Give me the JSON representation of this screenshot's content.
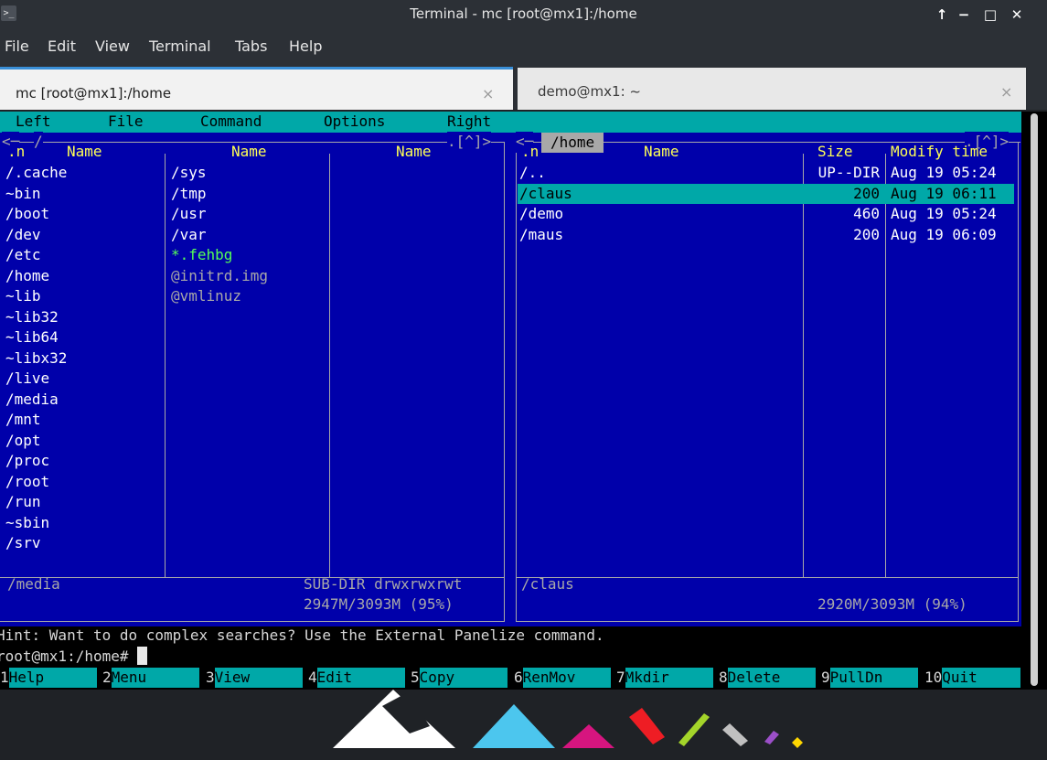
{
  "window": {
    "title": "Terminal - mc [root@mx1]:/home",
    "controls": {
      "up": "↑",
      "minimize": "−",
      "maximize": "□",
      "close": "✕"
    }
  },
  "menubar": [
    "File",
    "Edit",
    "View",
    "Terminal",
    "Tabs",
    "Help"
  ],
  "tabs": [
    {
      "label": "mc [root@mx1]:/home",
      "close": "×",
      "active": true
    },
    {
      "label": "demo@mx1: ~",
      "close": "×",
      "active": false
    }
  ],
  "mc": {
    "menu": [
      "Left",
      "File",
      "Command",
      "Options",
      "Right"
    ],
    "left_panel": {
      "path_label": "/",
      "left_corner": "<─",
      "right_corner": ".[^]>",
      "headers": [
        ".n",
        "Name",
        "Name",
        "Name"
      ],
      "col1": [
        "/.cache",
        "~bin",
        "/boot",
        "/dev",
        "/etc",
        "/home",
        "~lib",
        "~lib32",
        "~lib64",
        "~libx32",
        "/live",
        "/media",
        "/mnt",
        "/opt",
        "/proc",
        "/root",
        "/run",
        "~sbin",
        "/srv"
      ],
      "col2": [
        {
          "name": "/sys",
          "style": "normal"
        },
        {
          "name": "/tmp",
          "style": "normal"
        },
        {
          "name": "/usr",
          "style": "normal"
        },
        {
          "name": "/var",
          "style": "normal"
        },
        {
          "name": "*.fehbg",
          "style": "exec"
        },
        {
          "name": "@initrd.img",
          "style": "link"
        },
        {
          "name": "@vmlinuz",
          "style": "link"
        }
      ],
      "status_name": "/media",
      "status_info": "SUB-DIR drwxrwxrwt",
      "disk": "2947M/3093M (95%)"
    },
    "right_panel": {
      "path_label": "/home",
      "left_corner": "<─",
      "right_corner": ".[^]>",
      "headers": {
        "n": ".n",
        "name": "Name",
        "size": "Size",
        "mtime": "Modify time"
      },
      "rows": [
        {
          "name": "/..",
          "size": "UP--DIR",
          "mtime": "Aug 19 05:24",
          "selected": false
        },
        {
          "name": "/claus",
          "size": "200",
          "mtime": "Aug 19 06:11",
          "selected": true
        },
        {
          "name": "/demo",
          "size": "460",
          "mtime": "Aug 19 05:24",
          "selected": false
        },
        {
          "name": "/maus",
          "size": "200",
          "mtime": "Aug 19 06:09",
          "selected": false
        }
      ],
      "status_name": "/claus",
      "disk": "2920M/3093M (94%)"
    },
    "hint": "Hint: Want to do complex searches? Use the External Panelize command.",
    "prompt": "root@mx1:/home# ",
    "fkeys": [
      {
        "num": "1",
        "label": "Help"
      },
      {
        "num": "2",
        "label": "Menu"
      },
      {
        "num": "3",
        "label": "View"
      },
      {
        "num": "4",
        "label": "Edit"
      },
      {
        "num": "5",
        "label": "Copy"
      },
      {
        "num": "6",
        "label": "RenMov"
      },
      {
        "num": "7",
        "label": "Mkdir"
      },
      {
        "num": "8",
        "label": "Delete"
      },
      {
        "num": "9",
        "label": "PullDn"
      },
      {
        "num": "10",
        "label": "Quit"
      }
    ]
  },
  "colors": {
    "panel_bg": "#0000aa",
    "menu_bg": "#00a8a8",
    "header_fg": "#ffff55",
    "exec_fg": "#55ff55",
    "link_fg": "#a8a8a8",
    "tab_accent": "#3a8fd8"
  }
}
